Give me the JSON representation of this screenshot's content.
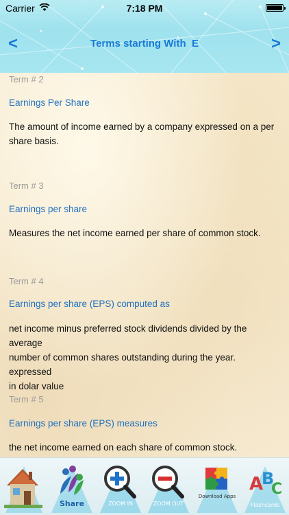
{
  "status_bar": {
    "carrier": "Carrier",
    "time": "7:18 PM"
  },
  "nav": {
    "title": "Terms starting With  E",
    "prev_symbol": "<",
    "next_symbol": ">"
  },
  "terms": [
    {
      "number_label": "Term # 2",
      "title": "Earnings Per Share",
      "definition_lines": [
        "The amount of income earned by a company expressed on a per",
        "share basis."
      ]
    },
    {
      "number_label": "Term # 3",
      "title": "Earnings per share",
      "definition_lines": [
        "Measures the net income earned per share of common stock."
      ]
    },
    {
      "number_label": "Term # 4",
      "title": "Earnings per share (EPS) computed as",
      "definition_lines": [
        "net income minus preferred stock dividends divided by the average",
        "number of common shares outstanding during the year. expressed",
        "in dolar value"
      ]
    },
    {
      "number_label": "Term # 5",
      "title": "Earnings per share (EPS) measures",
      "definition_lines": [
        "the net income earned on each share of common stock."
      ]
    }
  ],
  "tabbar": {
    "items": [
      {
        "name": "home",
        "icon": "house-icon",
        "caption": ""
      },
      {
        "name": "share",
        "icon": "share-people-icon",
        "caption": "Share"
      },
      {
        "name": "zoom-in",
        "icon": "magnifier-plus-icon",
        "caption": "ZOOM IN"
      },
      {
        "name": "zoom-out",
        "icon": "magnifier-minus-icon",
        "caption": "ZOOM OUT"
      },
      {
        "name": "puzzle",
        "icon": "puzzle-icon",
        "caption": "Download Apps"
      },
      {
        "name": "abc",
        "icon": "abc-blocks-icon",
        "caption": "Flashcards"
      }
    ]
  },
  "colors": {
    "accent_blue": "#1a7bd6",
    "term_title": "#1f6fbf",
    "term_label": "#9a9a9a",
    "header_bg": "#a6e6f0"
  }
}
